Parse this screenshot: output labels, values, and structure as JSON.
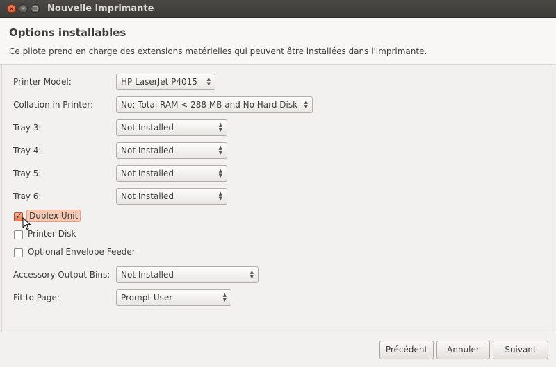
{
  "window": {
    "title": "Nouvelle imprimante",
    "close_glyph": "×",
    "min_glyph": "–",
    "max_glyph": "□"
  },
  "header": {
    "title": "Options installables",
    "description": "Ce pilote prend en charge des extensions matérielles qui peuvent être installées dans l'imprimante."
  },
  "options": {
    "printer_model": {
      "label": "Printer Model:",
      "value": "HP LaserJet P4015"
    },
    "collation": {
      "label": "Collation in Printer:",
      "value": "No: Total RAM < 288 MB and No Hard Disk"
    },
    "tray3": {
      "label": "Tray 3:",
      "value": "Not Installed"
    },
    "tray4": {
      "label": "Tray 4:",
      "value": "Not Installed"
    },
    "tray5": {
      "label": "Tray 5:",
      "value": "Not Installed"
    },
    "tray6": {
      "label": "Tray 6:",
      "value": "Not Installed"
    },
    "duplex_unit": {
      "label": "Duplex Unit",
      "checked": true
    },
    "printer_disk": {
      "label": "Printer Disk",
      "checked": false
    },
    "envelope_feeder": {
      "label": "Optional Envelope Feeder",
      "checked": false
    },
    "output_bins": {
      "label": "Accessory Output Bins:",
      "value": "Not Installed"
    },
    "fit_to_page": {
      "label": "Fit to Page:",
      "value": "Prompt User"
    }
  },
  "footer": {
    "previous": "Précédent",
    "cancel": "Annuler",
    "next": "Suivant"
  },
  "icons": {
    "combo_arrows": "updown-chevron-icon",
    "check": "checkmark-icon",
    "cursor": "mouse-pointer-icon"
  },
  "colors": {
    "accent": "#e77a52",
    "titlebar": "#3c3b37",
    "window_bg": "#f2f1f0"
  }
}
